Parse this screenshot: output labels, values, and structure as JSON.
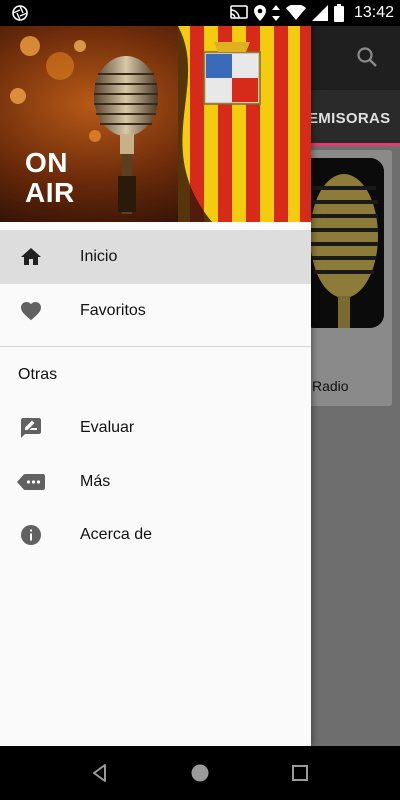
{
  "status_bar": {
    "time": "13:42",
    "icons": [
      "camera-aperture-icon",
      "cast-icon",
      "location-icon",
      "data-arrows-icon",
      "wifi-icon",
      "signal-icon",
      "battery-icon"
    ]
  },
  "app": {
    "tab_label": "EMISORAS",
    "card_text": "Radio",
    "accent_color": "#e53b6e",
    "search_icon": "search-icon"
  },
  "drawer": {
    "header": {
      "on_air_line1": "ON",
      "on_air_line2": "AIR"
    },
    "items": [
      {
        "label": "Inicio",
        "icon": "home-icon",
        "active": true
      },
      {
        "label": "Favoritos",
        "icon": "heart-icon",
        "active": false
      }
    ],
    "section_title": "Otras",
    "other_items": [
      {
        "label": "Evaluar",
        "icon": "rate-review-icon"
      },
      {
        "label": "Más",
        "icon": "more-tag-icon"
      },
      {
        "label": "Acerca de",
        "icon": "info-icon"
      }
    ]
  },
  "nav_bar": {
    "buttons": [
      "back-icon",
      "home-circle-icon",
      "recents-square-icon"
    ]
  }
}
